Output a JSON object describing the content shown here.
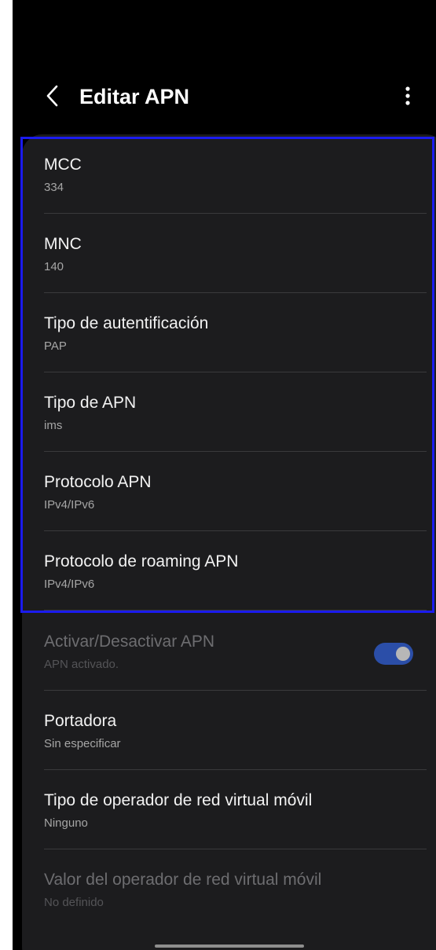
{
  "header": {
    "title": "Editar APN",
    "back_icon": "chevron-left-icon",
    "more_icon": "more-vertical-icon"
  },
  "items": [
    {
      "title": "MCC",
      "value": "334"
    },
    {
      "title": "MNC",
      "value": "140"
    },
    {
      "title": "Tipo de autentificación",
      "value": "PAP"
    },
    {
      "title": "Tipo de APN",
      "value": "ims"
    },
    {
      "title": "Protocolo APN",
      "value": "IPv4/IPv6"
    },
    {
      "title": "Protocolo de roaming APN",
      "value": "IPv4/IPv6"
    },
    {
      "title": "Activar/Desactivar APN",
      "value": "APN activado.",
      "enabled": false,
      "toggle_on": true
    },
    {
      "title": "Portadora",
      "value": "Sin especificar"
    },
    {
      "title": "Tipo de operador de red virtual móvil",
      "value": "Ninguno"
    },
    {
      "title": "Valor del operador de red virtual móvil",
      "value": "No definido",
      "enabled": false
    }
  ],
  "colors": {
    "background": "#000000",
    "card": "#1c1c1e",
    "toggle_track": "#2b4ea8",
    "highlight_border": "#1b1bef"
  }
}
